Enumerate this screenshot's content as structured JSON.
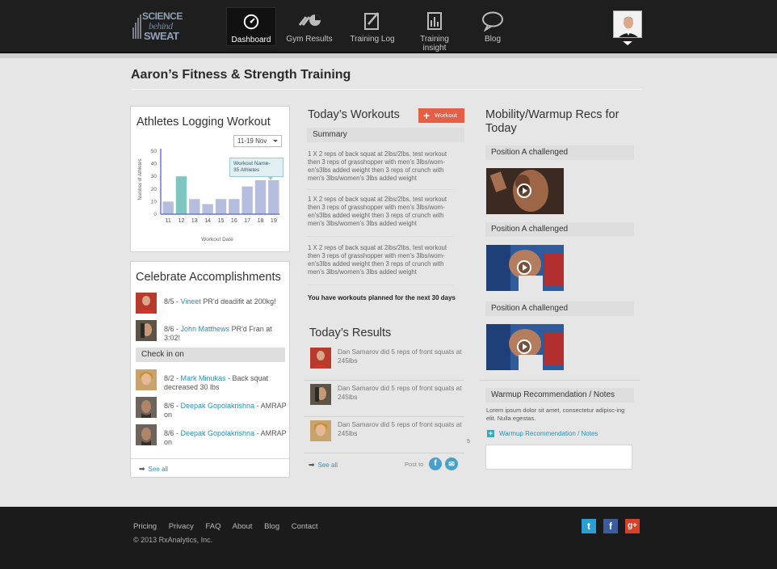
{
  "brand": {
    "line1": "SCIENCE",
    "line2": "behind",
    "line3": "SWEAT"
  },
  "nav": [
    {
      "label": "Dashboard",
      "icon": "gauge-icon",
      "active": true
    },
    {
      "label": "Gym Results",
      "icon": "results-icon"
    },
    {
      "label": "Training Log",
      "icon": "log-icon"
    },
    {
      "label": "Training insight",
      "icon": "insight-icon"
    },
    {
      "label": "Blog",
      "icon": "speech-bubble-icon"
    }
  ],
  "page_title": "Aaron’s Fitness & Strength Training",
  "athletes": {
    "title": "Athletes Logging Workout",
    "date_range": "11-19 Nov",
    "tooltip_line1": "Workout Name-",
    "tooltip_line2": "35 Athletes",
    "ylabel": "Number of Athletes",
    "xlabel": "Workout Date"
  },
  "chart_data": {
    "type": "bar",
    "title": "Athletes Logging Workout",
    "xlabel": "Workout Date",
    "ylabel": "Number of Athletes",
    "categories": [
      "11",
      "12",
      "13",
      "14",
      "15",
      "16",
      "17",
      "18",
      "19"
    ],
    "values": [
      10,
      30,
      12,
      8,
      12,
      12,
      22,
      27,
      27
    ],
    "highlight_index": 1,
    "yticks": [
      0,
      10,
      20,
      30,
      40,
      50
    ],
    "ylim": [
      0,
      50
    ],
    "bar_color": "#b6bedf",
    "highlight_color": "#7fc6c1"
  },
  "accomplishments": {
    "title": "Celebrate Accomplishments",
    "items": [
      {
        "date": "8/5",
        "name": "Vineet",
        "text": "PR'd deadifit at 200kg!"
      },
      {
        "date": "8/6",
        "name": "John Matthews",
        "text": "PR'd Fran at 3:02!"
      }
    ],
    "checkin_label": "Check in on",
    "checkins": [
      {
        "date": "8/2",
        "name": "Mark Minukas",
        "text": "Back squat decreased 30 lbs"
      },
      {
        "date": "8/6",
        "name": "Deepak Gopolakrishna",
        "text": "AMRAP on"
      },
      {
        "date": "8/6",
        "name": "Deepak Gopolakrishna",
        "text": "AMRAP on"
      }
    ],
    "see_all": "See all"
  },
  "workouts": {
    "title": "Today’s Workouts",
    "button": "Workout",
    "summary_label": "Summary",
    "items": [
      "1 X 2 reps of back squat at 2ibs/2lbs, test workout then 3 reps of grasshopper with men’s 3lbs/wom-en’s3lbs added weight then 3 reps of crunch with men’s 3lbs/women’s 3lbs added weight",
      "1 X 2 reps of back squat at 2ibs/2lbs, test workout then 3 reps of grasshopper with men’s 3lbs/wom-en’s3lbs added weight then 3 reps of crunch with men’s 3lbs/women’s 3lbs added weight",
      "1 X 2 reps of back squat at 2ibs/2lbs, test workout then 3 reps of grasshopper with men’s 3lbs/wom-en’s3lbs added weight then 3 reps of crunch with men’s 3lbs/women’s 3lbs added weight"
    ],
    "planned_note": "You have workouts planned for the next 30 days"
  },
  "results": {
    "title": "Today’s Results",
    "items": [
      "Dan Samarov did 5 reps of front squats at 245lbs",
      "Dan Samarov did 5 reps of front squats at 245lbs",
      "Dan Samarov did 5 reps of front squats at 245lbs"
    ],
    "stray_mark": "5",
    "see_all": "See all",
    "post_to": "Post to"
  },
  "mobility": {
    "title": "Mobility/Warmup Recs for Today",
    "videos": [
      {
        "label": "Position A challenged"
      },
      {
        "label": "Position A challenged"
      },
      {
        "label": "Position A challenged"
      }
    ],
    "notes_header": "Warmup Recommendation / Notes",
    "notes_text": "Lorem ipsum dolor sit amet, consectetur adipisc-ing elit. Nulla egestas.",
    "notes_link": "Warmup Recommendation / Notes"
  },
  "footer": {
    "links": [
      "Pricing",
      "Privacy",
      "FAQ",
      "About",
      "Blog",
      "Contact"
    ],
    "copyright": "© 2013 RxAnalytics, Inc."
  }
}
